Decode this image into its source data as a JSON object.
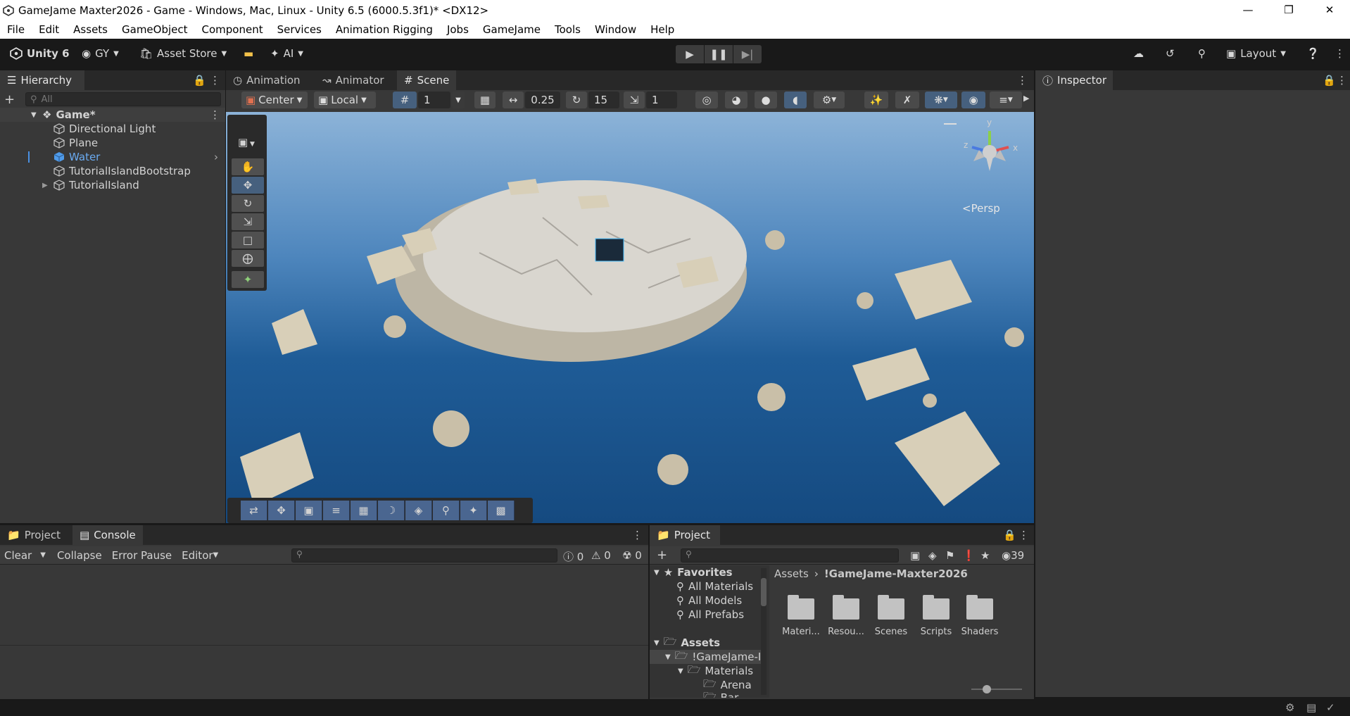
{
  "window": {
    "title": "GameJame Maxter2026 - Game - Windows, Mac, Linux - Unity 6.5 (6000.5.3f1)* <DX12>"
  },
  "menu": [
    "File",
    "Edit",
    "Assets",
    "GameObject",
    "Component",
    "Services",
    "Animation Rigging",
    "Jobs",
    "GameJame",
    "Tools",
    "Window",
    "Help"
  ],
  "toolbar": {
    "unity_label": "Unity 6",
    "account": "GY",
    "asset_store": "Asset Store",
    "ai": "AI",
    "layout": "Layout"
  },
  "hierarchy": {
    "tab": "Hierarchy",
    "search_placeholder": "All",
    "scene": "Game*",
    "items": [
      "Directional Light",
      "Plane",
      "Water",
      "TutorialIslandBootstrap",
      "TutorialIsland"
    ]
  },
  "scene_tabs": {
    "animation": "Animation",
    "animator": "Animator",
    "scene": "Scene"
  },
  "scene_toolbar": {
    "pivot": "Center",
    "space": "Local",
    "grid_size": "1",
    "snap_value": "0.25",
    "rotate_snap": "15",
    "scale_snap": "1"
  },
  "gizmo": {
    "y": "y",
    "x": "x",
    "z": "z",
    "persp": "Persp"
  },
  "inspector": {
    "tab": "Inspector"
  },
  "console": {
    "tabs": [
      "Project",
      "Console"
    ],
    "clear": "Clear",
    "collapse": "Collapse",
    "error_pause": "Error Pause",
    "editor": "Editor",
    "count_log": "0",
    "count_warn": "0",
    "count_err": "0"
  },
  "project": {
    "tab": "Project",
    "count": "39",
    "breadcrumb_root": "Assets",
    "breadcrumb_current": "!GameJame-Maxter2026",
    "favorites": "Favorites",
    "fav_items": [
      "All Materials",
      "All Models",
      "All Prefabs"
    ],
    "assets": "Assets",
    "tree": [
      "!GameJame-I",
      "Materials",
      "Arena",
      "Bar"
    ],
    "folders": [
      "Materi...",
      "Resou...",
      "Scenes",
      "Scripts",
      "Shaders"
    ]
  }
}
